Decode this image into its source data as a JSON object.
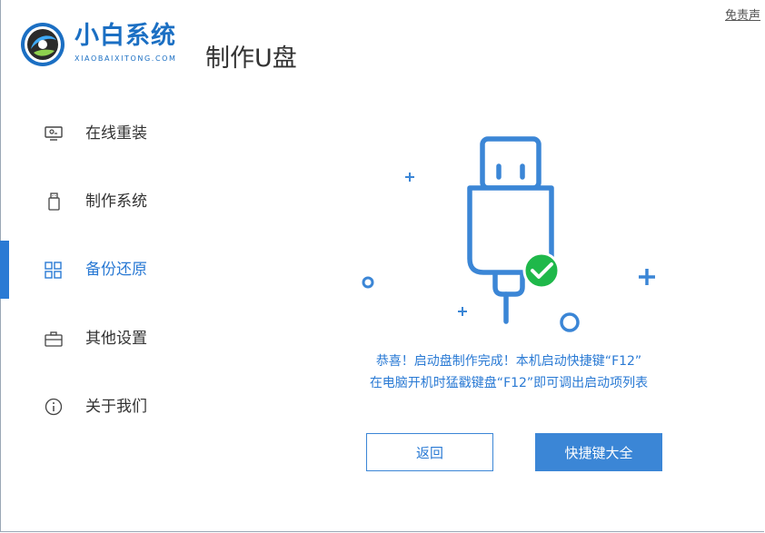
{
  "header": {
    "brand_name": "小白系统",
    "brand_domain": "XIAOBAIXITONG.COM",
    "page_title": "制作U盘",
    "disclaimer": "免责声"
  },
  "sidebar": {
    "active_index": 2,
    "items": [
      {
        "label": "在线重装",
        "icon": "monitor-icon"
      },
      {
        "label": "制作系统",
        "icon": "usb-icon"
      },
      {
        "label": "备份还原",
        "icon": "grid-icon"
      },
      {
        "label": "其他设置",
        "icon": "briefcase-icon"
      },
      {
        "label": "关于我们",
        "icon": "info-icon"
      }
    ]
  },
  "main": {
    "message_line1": "恭喜！启动盘制作完成！本机启动快捷键“F12”",
    "message_line2": "在电脑开机时猛戳键盘“F12”即可调出启动项列表",
    "back_label": "返回",
    "hotkeys_label": "快捷键大全",
    "illustration": {
      "icon": "usb-drive-success-icon",
      "status": "success"
    }
  },
  "colors": {
    "accent": "#2a7ad4",
    "brand": "#1b6fc3",
    "success": "#1fb84a",
    "text": "#333333"
  }
}
